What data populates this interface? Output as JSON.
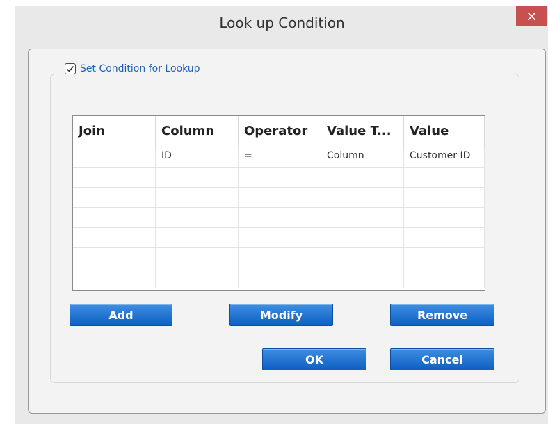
{
  "window": {
    "title": "Look up Condition",
    "close_glyph": "×"
  },
  "group": {
    "checkbox_checked": true,
    "checkbox_glyph": "✓",
    "label": "Set Condition for Lookup"
  },
  "grid": {
    "columns": [
      "Join",
      "Column",
      "Operator",
      "Value T...",
      "Value"
    ],
    "rows": [
      [
        "",
        "ID",
        "=",
        "Column",
        "Customer ID"
      ],
      [
        "",
        "",
        "",
        "",
        ""
      ],
      [
        "",
        "",
        "",
        "",
        ""
      ],
      [
        "",
        "",
        "",
        "",
        ""
      ],
      [
        "",
        "",
        "",
        "",
        ""
      ],
      [
        "",
        "",
        "",
        "",
        ""
      ],
      [
        "",
        "",
        "",
        "",
        ""
      ]
    ]
  },
  "buttons": {
    "add": "Add",
    "modify": "Modify",
    "remove": "Remove",
    "ok": "OK",
    "cancel": "Cancel"
  },
  "colors": {
    "accent": "#1d62b8",
    "button": "#1a6fd1",
    "close": "#c75050"
  }
}
